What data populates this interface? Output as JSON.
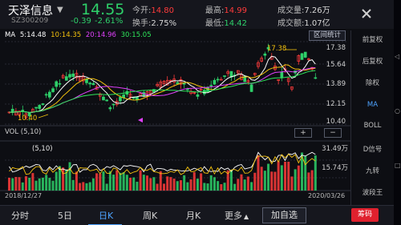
{
  "header": {
    "stock_name": "天泽信息",
    "caret": "▼",
    "stock_code": "SZ300209",
    "price": "14.55",
    "change": "-0.39",
    "change_pct": "-2.61%",
    "open_label": "今开:",
    "open_value": "14.80",
    "turnover_label": "换手:",
    "turnover_value": "2.75%",
    "high_label": "最高:",
    "high_value": "14.99",
    "low_label": "最低:",
    "low_value": "14.42",
    "vol_label": "成交量:",
    "vol_value": "7.26万",
    "amount_label": "成交额:",
    "amount_value": "1.07亿",
    "close_icon": "close-icon"
  },
  "ma": {
    "label": "MA",
    "time": "5:14.48",
    "ma10": "10:14.35",
    "ma20": "20:14.96",
    "ma30": "30:15.05",
    "colors": {
      "ma5": "#ffffff",
      "ma10": "#f4c20d",
      "ma20": "#e040fb",
      "ma30": "#2ee65a"
    }
  },
  "zone_stats_label": "区间统计",
  "price_axis": [
    "17.38",
    "15.64",
    "13.89",
    "12.15",
    "10.40"
  ],
  "price_annotations": {
    "high": "17.38",
    "low": "10.40"
  },
  "right_panel": [
    "前复权",
    "后复权",
    "除权",
    "MA",
    "BOLL",
    "D信号",
    "九转",
    "波段王"
  ],
  "right_panel_active": 3,
  "volume": {
    "label": "VOL (5,10)",
    "sub_label": "(5,10)",
    "axis": [
      "31.49万",
      "15.74万"
    ],
    "plus": "+",
    "minus": "−"
  },
  "dates": {
    "start": "2018/12/27",
    "end": "2020/03/26"
  },
  "tabs": [
    "分时",
    "5日",
    "日K",
    "周K",
    "月K",
    "更多"
  ],
  "tab_selected": 2,
  "more_caret": "▲",
  "add_watch": "加自选",
  "red_button": "筹码",
  "colors": {
    "up": "#ff3b3b",
    "down": "#2ed06a",
    "accent": "#4ea3ff",
    "bg": "#0d0e13"
  }
}
